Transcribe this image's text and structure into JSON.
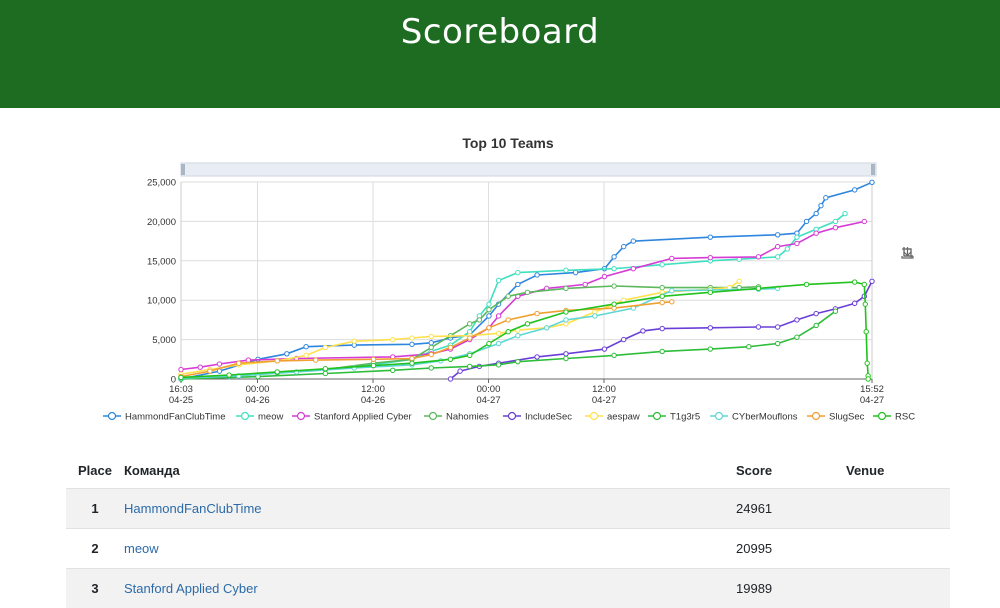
{
  "header": {
    "title": "Scoreboard"
  },
  "toolbar": {
    "icons": [
      "zoom-icon",
      "zoom-reset-icon",
      "download-icon"
    ]
  },
  "chart_data": {
    "type": "line",
    "title": "Top 10 Teams",
    "xlabel": "",
    "ylabel": "",
    "x_tick_labels": [
      [
        "16:03",
        "04-25"
      ],
      [
        "00:00",
        "04-26"
      ],
      [
        "12:00",
        "04-26"
      ],
      [
        "00:00",
        "04-27"
      ],
      [
        "12:00",
        "04-27"
      ],
      [
        "15:52",
        "04-27"
      ]
    ],
    "x_range_hours": [
      0,
      71.8
    ],
    "x_unit": "hours since 04-25 16:03",
    "ylim": [
      0,
      25000
    ],
    "y_ticks": [
      "0",
      "5,000",
      "10,000",
      "15,000",
      "20,000",
      "25,000"
    ],
    "grid": true,
    "legend_position": "bottom",
    "series": [
      {
        "name": "HammondFanClubTime",
        "color": "#2e86de",
        "points": [
          [
            0,
            0
          ],
          [
            4,
            1000
          ],
          [
            8,
            2500
          ],
          [
            11,
            3200
          ],
          [
            13,
            4100
          ],
          [
            18,
            4300
          ],
          [
            24,
            4400
          ],
          [
            26,
            4600
          ],
          [
            28,
            5200
          ],
          [
            30,
            5600
          ],
          [
            32,
            8000
          ],
          [
            33,
            9500
          ],
          [
            35,
            12000
          ],
          [
            37,
            13200
          ],
          [
            41,
            13500
          ],
          [
            44,
            14000
          ],
          [
            45,
            15500
          ],
          [
            46,
            16800
          ],
          [
            47,
            17500
          ],
          [
            55,
            18000
          ],
          [
            62,
            18300
          ],
          [
            64,
            18500
          ],
          [
            65,
            20000
          ],
          [
            66,
            21000
          ],
          [
            66.5,
            22000
          ],
          [
            67,
            23000
          ],
          [
            70,
            24000
          ],
          [
            71.8,
            24961
          ]
        ]
      },
      {
        "name": "meow",
        "color": "#40e0c0",
        "points": [
          [
            0,
            0
          ],
          [
            5,
            300
          ],
          [
            10,
            800
          ],
          [
            15,
            1200
          ],
          [
            20,
            1800
          ],
          [
            24,
            2500
          ],
          [
            26,
            3500
          ],
          [
            28,
            4300
          ],
          [
            30,
            6000
          ],
          [
            31,
            8000
          ],
          [
            32,
            9500
          ],
          [
            33,
            12500
          ],
          [
            35,
            13500
          ],
          [
            40,
            13800
          ],
          [
            45,
            14000
          ],
          [
            50,
            14500
          ],
          [
            55,
            15000
          ],
          [
            58,
            15200
          ],
          [
            62,
            15500
          ],
          [
            63,
            16500
          ],
          [
            64,
            18000
          ],
          [
            66,
            19000
          ],
          [
            68,
            20000
          ],
          [
            69,
            20995
          ]
        ]
      },
      {
        "name": "Stanford Applied Cyber",
        "color": "#d63bd6",
        "points": [
          [
            0,
            1200
          ],
          [
            2,
            1500
          ],
          [
            4,
            1900
          ],
          [
            7,
            2400
          ],
          [
            12,
            2600
          ],
          [
            22,
            2800
          ],
          [
            26,
            3200
          ],
          [
            28,
            3800
          ],
          [
            30,
            5000
          ],
          [
            32,
            6500
          ],
          [
            33,
            8000
          ],
          [
            35,
            10500
          ],
          [
            38,
            11500
          ],
          [
            42,
            12000
          ],
          [
            44,
            13000
          ],
          [
            47,
            14000
          ],
          [
            51,
            15300
          ],
          [
            55,
            15400
          ],
          [
            60,
            15500
          ],
          [
            62,
            16800
          ],
          [
            64,
            17200
          ],
          [
            66,
            18500
          ],
          [
            68,
            19200
          ],
          [
            71,
            19989
          ]
        ]
      },
      {
        "name": "Nahomies",
        "color": "#5cb85c",
        "points": [
          [
            0,
            200
          ],
          [
            5,
            400
          ],
          [
            10,
            800
          ],
          [
            15,
            1200
          ],
          [
            20,
            2000
          ],
          [
            24,
            2500
          ],
          [
            26,
            4000
          ],
          [
            28,
            5500
          ],
          [
            30,
            7000
          ],
          [
            31,
            7500
          ],
          [
            32,
            8800
          ],
          [
            34,
            10500
          ],
          [
            36,
            11000
          ],
          [
            40,
            11500
          ],
          [
            45,
            11800
          ],
          [
            50,
            11600
          ],
          [
            55,
            11600
          ],
          [
            58,
            11600
          ],
          [
            60,
            11700
          ]
        ]
      },
      {
        "name": "IncludeSec",
        "color": "#6a3fd6",
        "points": [
          [
            28,
            0
          ],
          [
            29,
            1000
          ],
          [
            31,
            1600
          ],
          [
            33,
            2000
          ],
          [
            37,
            2800
          ],
          [
            40,
            3200
          ],
          [
            44,
            3800
          ],
          [
            46,
            5000
          ],
          [
            48,
            6100
          ],
          [
            50,
            6400
          ],
          [
            55,
            6500
          ],
          [
            60,
            6600
          ],
          [
            62,
            6600
          ],
          [
            64,
            7500
          ],
          [
            66,
            8300
          ],
          [
            68,
            8900
          ],
          [
            70,
            9600
          ],
          [
            71,
            10500
          ],
          [
            71.8,
            12400
          ]
        ]
      },
      {
        "name": "aespaw",
        "color": "#ffe14d",
        "points": [
          [
            0,
            600
          ],
          [
            3,
            1200
          ],
          [
            6,
            1800
          ],
          [
            10,
            2300
          ],
          [
            13,
            3000
          ],
          [
            15,
            4000
          ],
          [
            18,
            4800
          ],
          [
            22,
            5000
          ],
          [
            24,
            5200
          ],
          [
            26,
            5400
          ],
          [
            30,
            5500
          ],
          [
            33,
            5800
          ],
          [
            35,
            6200
          ],
          [
            38,
            6500
          ],
          [
            40,
            7000
          ],
          [
            43,
            8500
          ],
          [
            46,
            10000
          ],
          [
            50,
            11000
          ],
          [
            55,
            11400
          ],
          [
            57,
            11600
          ],
          [
            58,
            12400
          ]
        ]
      },
      {
        "name": "T1g3r5",
        "color": "#2dbd3a",
        "points": [
          [
            0,
            0
          ],
          [
            8,
            300
          ],
          [
            15,
            700
          ],
          [
            22,
            1100
          ],
          [
            26,
            1400
          ],
          [
            30,
            1600
          ],
          [
            33,
            1800
          ],
          [
            35,
            2200
          ],
          [
            40,
            2600
          ],
          [
            45,
            3000
          ],
          [
            50,
            3500
          ],
          [
            55,
            3800
          ],
          [
            59,
            4100
          ],
          [
            62,
            4500
          ],
          [
            64,
            5300
          ],
          [
            66,
            6800
          ],
          [
            68,
            8600
          ]
        ]
      },
      {
        "name": "CYberMouflons",
        "color": "#5fd6d6",
        "points": [
          [
            0,
            100
          ],
          [
            6,
            400
          ],
          [
            12,
            900
          ],
          [
            18,
            1400
          ],
          [
            24,
            1800
          ],
          [
            27,
            2300
          ],
          [
            30,
            3200
          ],
          [
            33,
            4500
          ],
          [
            35,
            5500
          ],
          [
            38,
            6500
          ],
          [
            40,
            7500
          ],
          [
            43,
            8000
          ],
          [
            47,
            9000
          ],
          [
            51,
            11200
          ],
          [
            55,
            11300
          ],
          [
            60,
            11400
          ],
          [
            62,
            11500
          ]
        ]
      },
      {
        "name": "SlugSec",
        "color": "#f0a030",
        "points": [
          [
            0,
            300
          ],
          [
            3,
            1000
          ],
          [
            6,
            2000
          ],
          [
            10,
            2300
          ],
          [
            14,
            2400
          ],
          [
            20,
            2500
          ],
          [
            24,
            2600
          ],
          [
            26,
            3100
          ],
          [
            28,
            4000
          ],
          [
            30,
            5200
          ],
          [
            32,
            6500
          ],
          [
            34,
            7500
          ],
          [
            37,
            8300
          ],
          [
            40,
            8700
          ],
          [
            45,
            9000
          ],
          [
            50,
            9700
          ],
          [
            51,
            9800
          ]
        ]
      },
      {
        "name": "RSC",
        "color": "#22c21e",
        "points": [
          [
            0,
            200
          ],
          [
            5,
            500
          ],
          [
            10,
            900
          ],
          [
            15,
            1300
          ],
          [
            20,
            1700
          ],
          [
            24,
            2000
          ],
          [
            28,
            2500
          ],
          [
            30,
            3000
          ],
          [
            32,
            4500
          ],
          [
            34,
            6000
          ],
          [
            36,
            7000
          ],
          [
            40,
            8500
          ],
          [
            45,
            9500
          ],
          [
            50,
            10500
          ],
          [
            55,
            11000
          ],
          [
            60,
            11500
          ],
          [
            65,
            12000
          ],
          [
            70,
            12300
          ],
          [
            71,
            12000
          ],
          [
            71.1,
            9500
          ],
          [
            71.2,
            6000
          ],
          [
            71.3,
            2000
          ],
          [
            71.4,
            400
          ],
          [
            71.4,
            0
          ]
        ]
      }
    ]
  },
  "table": {
    "headers": {
      "place": "Place",
      "team": "Команда",
      "score": "Score",
      "venue": "Venue"
    },
    "rows": [
      {
        "place": "1",
        "team": "HammondFanClubTime",
        "score": "24961",
        "venue": ""
      },
      {
        "place": "2",
        "team": "meow",
        "score": "20995",
        "venue": ""
      },
      {
        "place": "3",
        "team": "Stanford Applied Cyber",
        "score": "19989",
        "venue": ""
      }
    ]
  }
}
